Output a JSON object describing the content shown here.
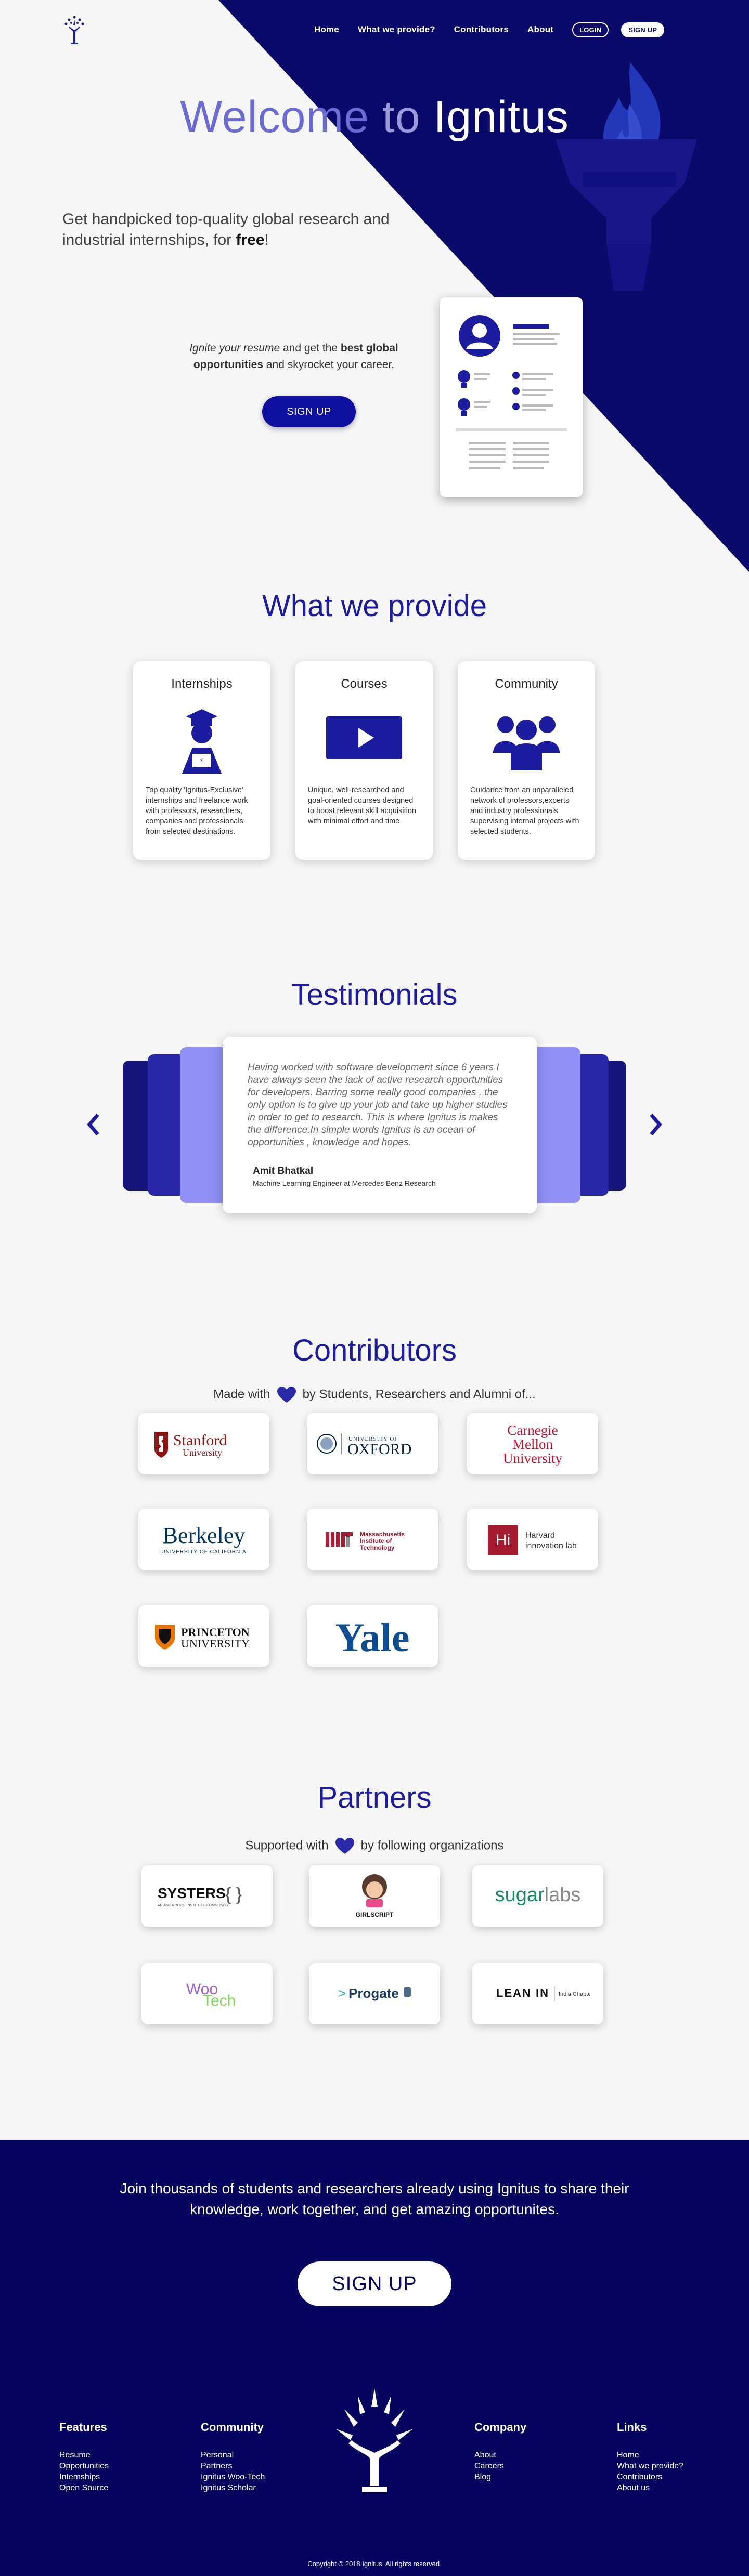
{
  "nav": {
    "home": "Home",
    "provide": "What we provide?",
    "contributors": "Contributors",
    "about": "About",
    "login": "LOGIN",
    "signup": "SIGN UP"
  },
  "hero": {
    "title_a": "Welcome",
    "title_b": "to",
    "title_c": "Ignitus",
    "subtitle_a": "Get handpicked top-quality global research and industrial internships, for",
    "subtitle_b": "free",
    "subtitle_c": "!",
    "note_a": "Ignite your resume",
    "note_b": "and get the",
    "note_c": "best global opportunities",
    "note_d": "and skyrocket your career.",
    "cta": "SIGN UP"
  },
  "provide": {
    "title": "What we provide",
    "cards": [
      {
        "title": "Internships",
        "text": "Top quality 'Ignitus-Exclusive' internships and freelance work with professors, researchers, companies and professionals from selected destinations."
      },
      {
        "title": "Courses",
        "text": "Unique, well-researched and goal-oriented courses designed to boost relevant skill acquisition with minimal effort and time."
      },
      {
        "title": "Community",
        "text": "Guidance from an unparalleled network of professors,experts and industry professionals supervising internal projects with selected students."
      }
    ]
  },
  "testimonials": {
    "title": "Testimonials",
    "quote": "Having worked with software development since 6 years I have always seen the lack of active research opportunities for developers. Barring some really good companies , the only option is to give up your job and take up higher studies in order to get to research. This is where Ignitus is makes the difference.In simple words Ignitus is an ocean of opportunities , knowledge and hopes.",
    "author": "Amit Bhatkal",
    "role": "Machine Learning Engineer at Mercedes Benz Research"
  },
  "contributors": {
    "title": "Contributors",
    "made_a": "Made with",
    "made_b": "by Students, Researchers and Alumni of...",
    "stanford": "Stanford",
    "stanford_sub": "University",
    "oxford_top": "UNIVERSITY OF",
    "oxford": "OXFORD",
    "cmu": [
      "Carnegie",
      "Mellon",
      "University"
    ],
    "berkeley": "Berkeley",
    "berkeley_sub": "UNIVERSITY OF CALIFORNIA",
    "mit": [
      "Massachusetts",
      "Institute of",
      "Technology"
    ],
    "harvard": [
      "Harvard",
      "innovation lab"
    ],
    "princeton": [
      "PRINCETON",
      "UNIVERSITY"
    ],
    "yale": "Yale"
  },
  "partners": {
    "title": "Partners",
    "supported_a": "Supported with",
    "supported_b": "by following organizations",
    "systers": "SYSTERS",
    "systers_sub": "AN ANITA BORG INSTITUTE COMMUNITY",
    "girlscript": "GIRLSCRIPT",
    "sugar_a": "sugar",
    "sugar_b": "labs",
    "woo": "Woo",
    "tech": "Tech",
    "progate": "Progate",
    "leanin": "LEAN IN",
    "leanin_sub": "India Chapter"
  },
  "footer": {
    "join": "Join thousands of students and researchers already using Ignitus to share their knowledge, work together, and get amazing opportunites.",
    "cta": "SIGN UP",
    "cols": [
      {
        "title": "Features",
        "links": [
          "Resume",
          "Opportunities",
          "Internships",
          "Open Source"
        ]
      },
      {
        "title": "Community",
        "links": [
          "Personal",
          "Partners",
          "Ignitus Woo-Tech",
          "Ignitus Scholar"
        ]
      },
      {
        "title": "Company",
        "links": [
          "About",
          "Careers",
          "Blog"
        ]
      },
      {
        "title": "Links",
        "links": [
          "Home",
          "What we provide?",
          "Contributors",
          "About us"
        ]
      }
    ],
    "copyright": "Copyright © 2018 Ignitus. All rights reserved."
  },
  "colors": {
    "brand": "#0a0a6b",
    "accent": "#1c1c9e",
    "heart": "#2a2aa8"
  }
}
